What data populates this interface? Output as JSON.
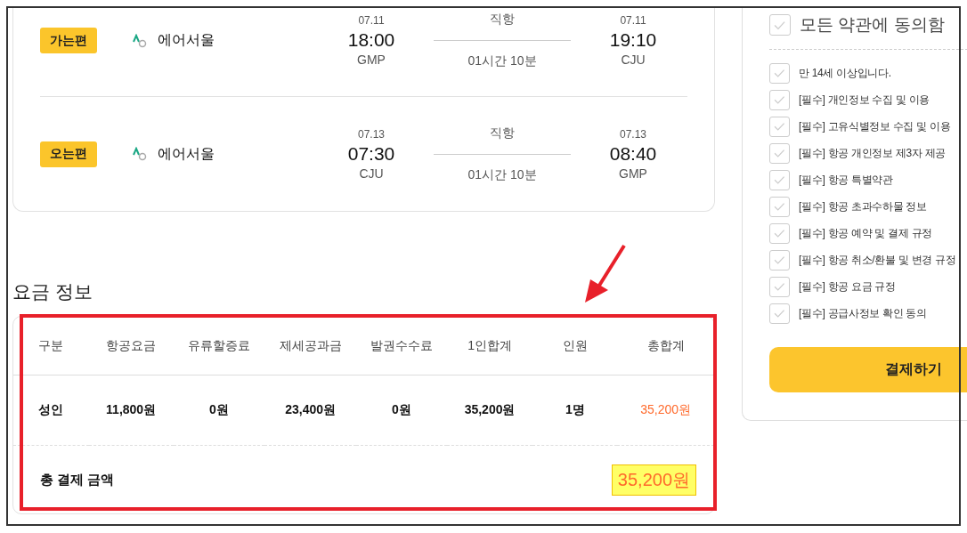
{
  "flights": [
    {
      "direction": "가는편",
      "airline": "에어서울",
      "depart": {
        "date": "07.11",
        "time": "18:00",
        "airport": "GMP"
      },
      "route_type": "직항",
      "duration": "01시간 10분",
      "arrive": {
        "date": "07.11",
        "time": "19:10",
        "airport": "CJU"
      }
    },
    {
      "direction": "오는편",
      "airline": "에어서울",
      "depart": {
        "date": "07.13",
        "time": "07:30",
        "airport": "CJU"
      },
      "route_type": "직항",
      "duration": "01시간 10분",
      "arrive": {
        "date": "07.13",
        "time": "08:40",
        "airport": "GMP"
      }
    }
  ],
  "fare": {
    "title": "요금 정보",
    "columns": [
      "구분",
      "항공요금",
      "유류할증료",
      "제세공과금",
      "발권수수료",
      "1인합계",
      "인원",
      "총합계"
    ],
    "rows": [
      [
        "성인",
        "11,800원",
        "0원",
        "23,400원",
        "0원",
        "35,200원",
        "1명",
        "35,200원"
      ]
    ],
    "total_label": "총 결제 금액",
    "total_value": "35,200원",
    "total_highlighted": true
  },
  "agreement": {
    "all": {
      "label": "모든 약관에 동의함",
      "checked": false
    },
    "items": [
      {
        "label": "만 14세 이상입니다.",
        "checked": false
      },
      {
        "label": "[필수] 개인정보 수집 및 이용",
        "checked": false
      },
      {
        "label": "[필수] 고유식별정보 수집 및 이용",
        "checked": false
      },
      {
        "label": "[필수] 항공 개인정보 제3자 제공",
        "checked": false
      },
      {
        "label": "[필수] 항공 특별약관",
        "checked": false
      },
      {
        "label": "[필수] 항공 초과수하물 정보",
        "checked": false
      },
      {
        "label": "[필수] 항공 예약 및 결제 규정",
        "checked": false
      },
      {
        "label": "[필수] 항공 취소/환불 및 변경 규정",
        "checked": false
      },
      {
        "label": "[필수] 항공 요금 규정",
        "checked": false
      },
      {
        "label": "[필수] 공급사정보 확인 동의",
        "checked": false
      }
    ],
    "pay_button": "결제하기"
  }
}
